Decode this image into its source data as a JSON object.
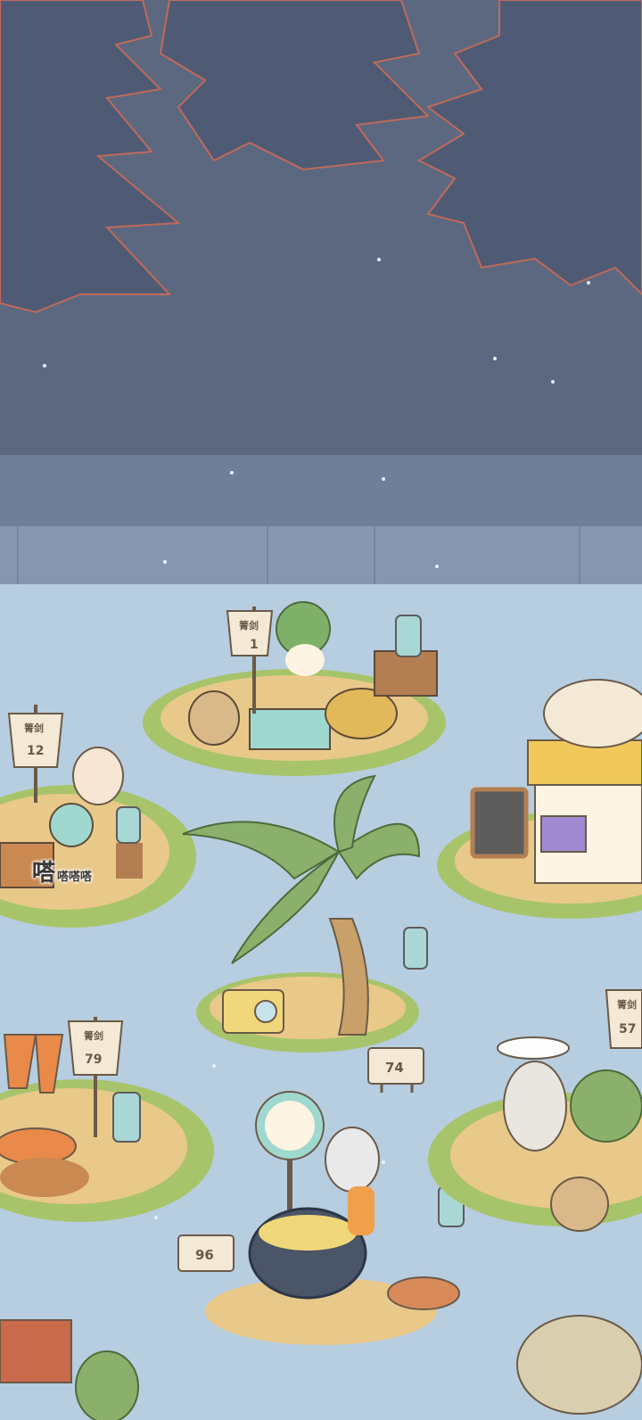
{
  "scene": {
    "sky_color": "#5b6880",
    "water_color": "#b7cde0",
    "sand_color": "#e9c98a",
    "grass_color": "#a7c46a"
  },
  "signs": {
    "top_label": "箐剑",
    "stall_1": "1",
    "stall_12": "12",
    "stall_79": "79",
    "stall_57": "57",
    "plate_74": "74",
    "plate_96": "96"
  },
  "sound_effect": {
    "main": "嗒",
    "trail": "嗒嗒嗒"
  },
  "icons": [
    "pine-tree-icon",
    "lantern-icon",
    "palm-tree-icon",
    "radio-icon",
    "pot-icon",
    "scale-icon",
    "cat-icon",
    "menu-board-icon",
    "cabbage-icon",
    "carrot-icon"
  ]
}
